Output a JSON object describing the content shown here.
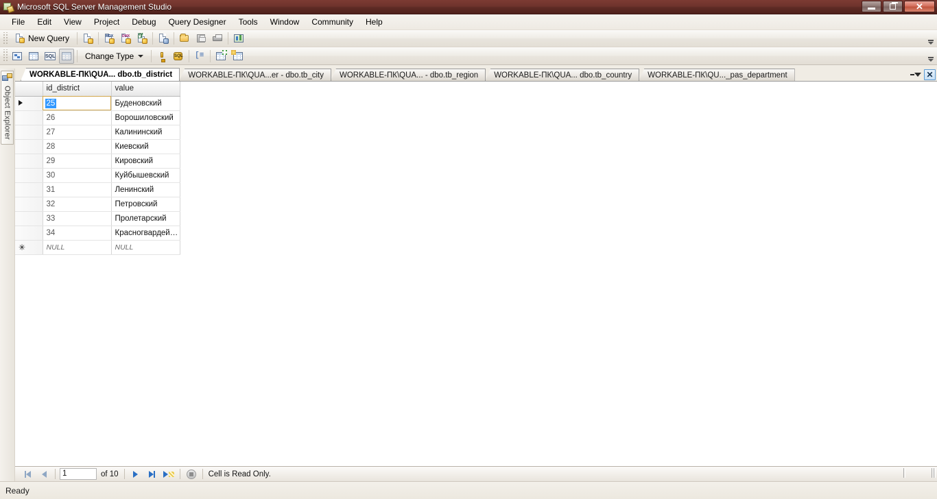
{
  "window": {
    "title": "Microsoft SQL Server Management Studio",
    "app_icon": "ssms-icon",
    "controls": {
      "minimize": "minimize-button",
      "restore": "restore-button",
      "close_label": "✕"
    }
  },
  "menubar": [
    {
      "label": "File",
      "accel": "F"
    },
    {
      "label": "Edit",
      "accel": "E"
    },
    {
      "label": "View",
      "accel": "V"
    },
    {
      "label": "Project",
      "accel": "P"
    },
    {
      "label": "Debug",
      "accel": "D"
    },
    {
      "label": "Query Designer",
      "accel": ""
    },
    {
      "label": "Tools",
      "accel": "T"
    },
    {
      "label": "Window",
      "accel": "W"
    },
    {
      "label": "Community",
      "accel": "C"
    },
    {
      "label": "Help",
      "accel": "H"
    }
  ],
  "toolbar_standard": {
    "new_query_label": "New Query",
    "new_query_icon": "new-query-icon",
    "buttons": [
      {
        "icon": "new-database-engine-query-icon",
        "name": "new-database-engine-query"
      },
      {
        "icon": "new-mdx-query-icon",
        "name": "new-mdx-query",
        "tag": "MDX"
      },
      {
        "icon": "new-dmx-query-icon",
        "name": "new-dmx-query",
        "tag": "DMX"
      },
      {
        "icon": "new-xmla-query-icon",
        "name": "new-xmla-query",
        "tag": "XMLA"
      },
      {
        "icon": "new-project-icon",
        "name": "new-project"
      },
      {
        "icon": "open-file-icon",
        "name": "open-file"
      },
      {
        "icon": "save-icon",
        "name": "save"
      },
      {
        "icon": "print-icon",
        "name": "print"
      },
      {
        "icon": "summary-chart-icon",
        "name": "summary"
      }
    ],
    "overflow": "toolbar-overflow"
  },
  "toolbar_querydesigner": {
    "change_type_label": "Change Type",
    "buttons": [
      {
        "icon": "show-diagram-pane-icon",
        "name": "show-diagram-pane"
      },
      {
        "icon": "show-criteria-pane-icon",
        "name": "show-criteria-pane"
      },
      {
        "icon": "show-sql-pane-icon",
        "name": "show-sql-pane"
      },
      {
        "icon": "show-results-pane-icon",
        "name": "show-results-pane",
        "state": "pressed"
      },
      {
        "icon": "verify-sql-icon",
        "name": "verify-sql"
      },
      {
        "icon": "execute-sql-icon",
        "name": "execute-sql"
      },
      {
        "icon": "group-by-icon",
        "name": "add-group-by"
      },
      {
        "icon": "add-table-icon",
        "name": "add-table"
      },
      {
        "icon": "add-new-derived-table-icon",
        "name": "add-new-derived-table"
      }
    ],
    "overflow": "toolbar-overflow"
  },
  "object_explorer": {
    "label": "Object Explorer",
    "icon": "object-explorer-icon"
  },
  "tabs": [
    {
      "label": "WORKABLE-ПК\\QUA... dbo.tb_district",
      "active": true
    },
    {
      "label": "WORKABLE-ПК\\QUA...er - dbo.tb_city",
      "active": false
    },
    {
      "label": "WORKABLE-ПК\\QUA... - dbo.tb_region",
      "active": false
    },
    {
      "label": "WORKABLE-ПК\\QUA... dbo.tb_country",
      "active": false
    },
    {
      "label": "WORKABLE-ПК\\QU..._pas_department",
      "active": false
    }
  ],
  "tabstrip_controls": {
    "dropdown": "tab-list-dropdown-icon",
    "close": "✕"
  },
  "grid": {
    "columns": [
      "id_district",
      "value"
    ],
    "selected_cell": {
      "row": 0,
      "column": "id_district",
      "value": "25"
    },
    "current_row_index": 0,
    "rows": [
      {
        "marker": "current",
        "id_district": "25",
        "value": "Буденовский"
      },
      {
        "marker": "",
        "id_district": "26",
        "value": "Ворошиловский"
      },
      {
        "marker": "",
        "id_district": "27",
        "value": "Калининский"
      },
      {
        "marker": "",
        "id_district": "28",
        "value": "Киевский"
      },
      {
        "marker": "",
        "id_district": "29",
        "value": "Кировский"
      },
      {
        "marker": "",
        "id_district": "30",
        "value": "Куйбышевский"
      },
      {
        "marker": "",
        "id_district": "31",
        "value": "Ленинский"
      },
      {
        "marker": "",
        "id_district": "32",
        "value": "Петровский"
      },
      {
        "marker": "",
        "id_district": "33",
        "value": "Пролетарский"
      },
      {
        "marker": "",
        "id_district": "34",
        "value": "Красногвардей…"
      },
      {
        "marker": "new",
        "id_district": "NULL",
        "value": "NULL"
      }
    ]
  },
  "navigator": {
    "first_label": "first-record",
    "prev_label": "previous-record",
    "page_value": "1",
    "of_label": "of 10",
    "next_label": "next-record",
    "last_label": "last-record",
    "new_label": "new-record",
    "stop_label": "stop",
    "message": "Cell is Read Only."
  },
  "statusbar": {
    "text": "Ready"
  },
  "colors": {
    "titlebar": "#6e332c",
    "selection": "#3399ff",
    "accent_blue": "#2a6fc4",
    "tab_active_bg": "#ffffff",
    "workspace_bg": "#f0ece4"
  }
}
